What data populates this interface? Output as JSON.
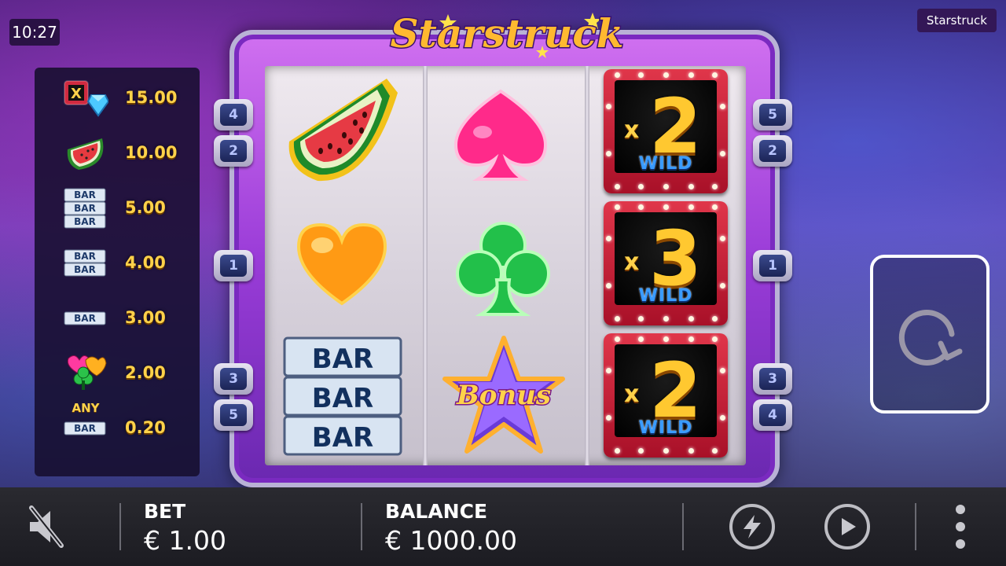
{
  "clock": "10:27",
  "game_tag": "Starstruck",
  "logo_text": "Starstruck",
  "paytable": [
    {
      "icon": "wild-diamond-icon",
      "value": "15.00"
    },
    {
      "icon": "watermelon-icon",
      "value": "10.00"
    },
    {
      "icon": "triple-bar-icon",
      "value": "5.00"
    },
    {
      "icon": "double-bar-icon",
      "value": "4.00"
    },
    {
      "icon": "single-bar-icon",
      "value": "3.00"
    },
    {
      "icon": "card-suits-icon",
      "value": "2.00"
    },
    {
      "icon": "any-bar-icon",
      "value": "0.20",
      "prefix": "ANY"
    }
  ],
  "bar_text": "BAR",
  "bonus_text": "Bonus",
  "paylines_left": [
    "4",
    "2",
    "1",
    "3",
    "5"
  ],
  "paylines_right": [
    "5",
    "2",
    "1",
    "3",
    "4"
  ],
  "wilds": [
    {
      "x": "x",
      "n": "2",
      "label": "WILD"
    },
    {
      "x": "x",
      "n": "3",
      "label": "WILD"
    },
    {
      "x": "x",
      "n": "2",
      "label": "WILD"
    }
  ],
  "bottom": {
    "bet_label": "BET",
    "bet_value": "€ 1.00",
    "balance_label": "BALANCE",
    "balance_value": "€ 1000.00"
  },
  "colors": {
    "gold": "#ffd24a",
    "wild_red": "#d02a40",
    "frame_purple": "#9a3cd8"
  }
}
